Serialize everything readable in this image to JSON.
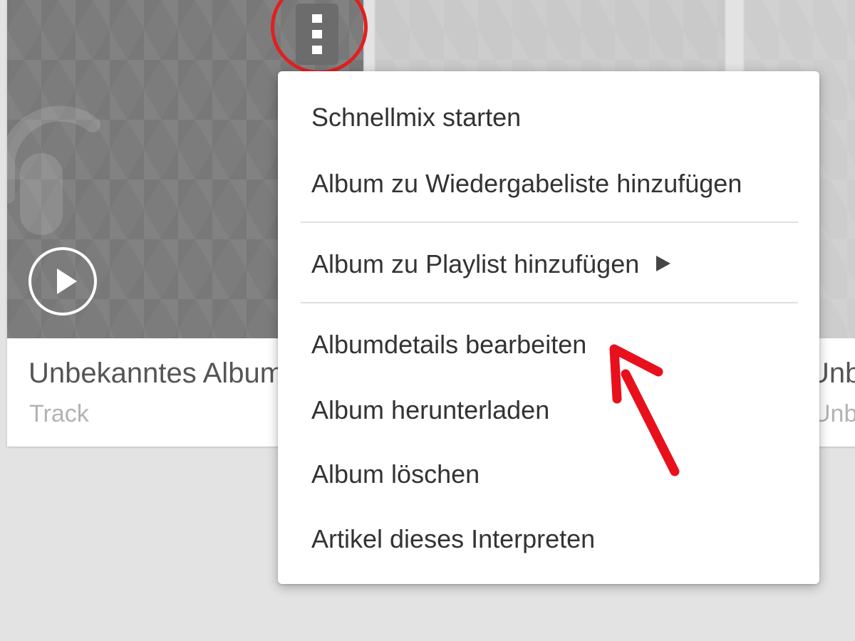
{
  "cards": {
    "left": {
      "title": "Unbekanntes Album",
      "subtitle": "Track",
      "art_icon": "headphones-icon",
      "play_icon": "play-icon"
    },
    "right": {
      "title": "Unbekanntes Album",
      "subtitle": "Unbekannter Interpret"
    }
  },
  "more_button": {
    "icon": "vertical-dots-icon"
  },
  "menu": {
    "items": [
      {
        "label": "Schnellmix starten"
      },
      {
        "label": "Album zu Wiedergabeliste hinzufügen"
      },
      {
        "label": "Album zu Playlist hinzufügen",
        "submenu_icon": "chevron-right-icon"
      },
      {
        "label": "Albumdetails bearbeiten"
      },
      {
        "label": "Album herunterladen"
      },
      {
        "label": "Album löschen"
      },
      {
        "label": "Artikel dieses Interpreten"
      }
    ]
  },
  "annotations": {
    "circle_color": "#e02020",
    "arrow_color": "#e8101c"
  },
  "colors": {
    "background": "#e3e3e3",
    "card_art_left": "#7c7c7c",
    "menu_background": "#ffffff",
    "menu_text": "#333333",
    "subtitle_text": "#b3b3b3"
  }
}
